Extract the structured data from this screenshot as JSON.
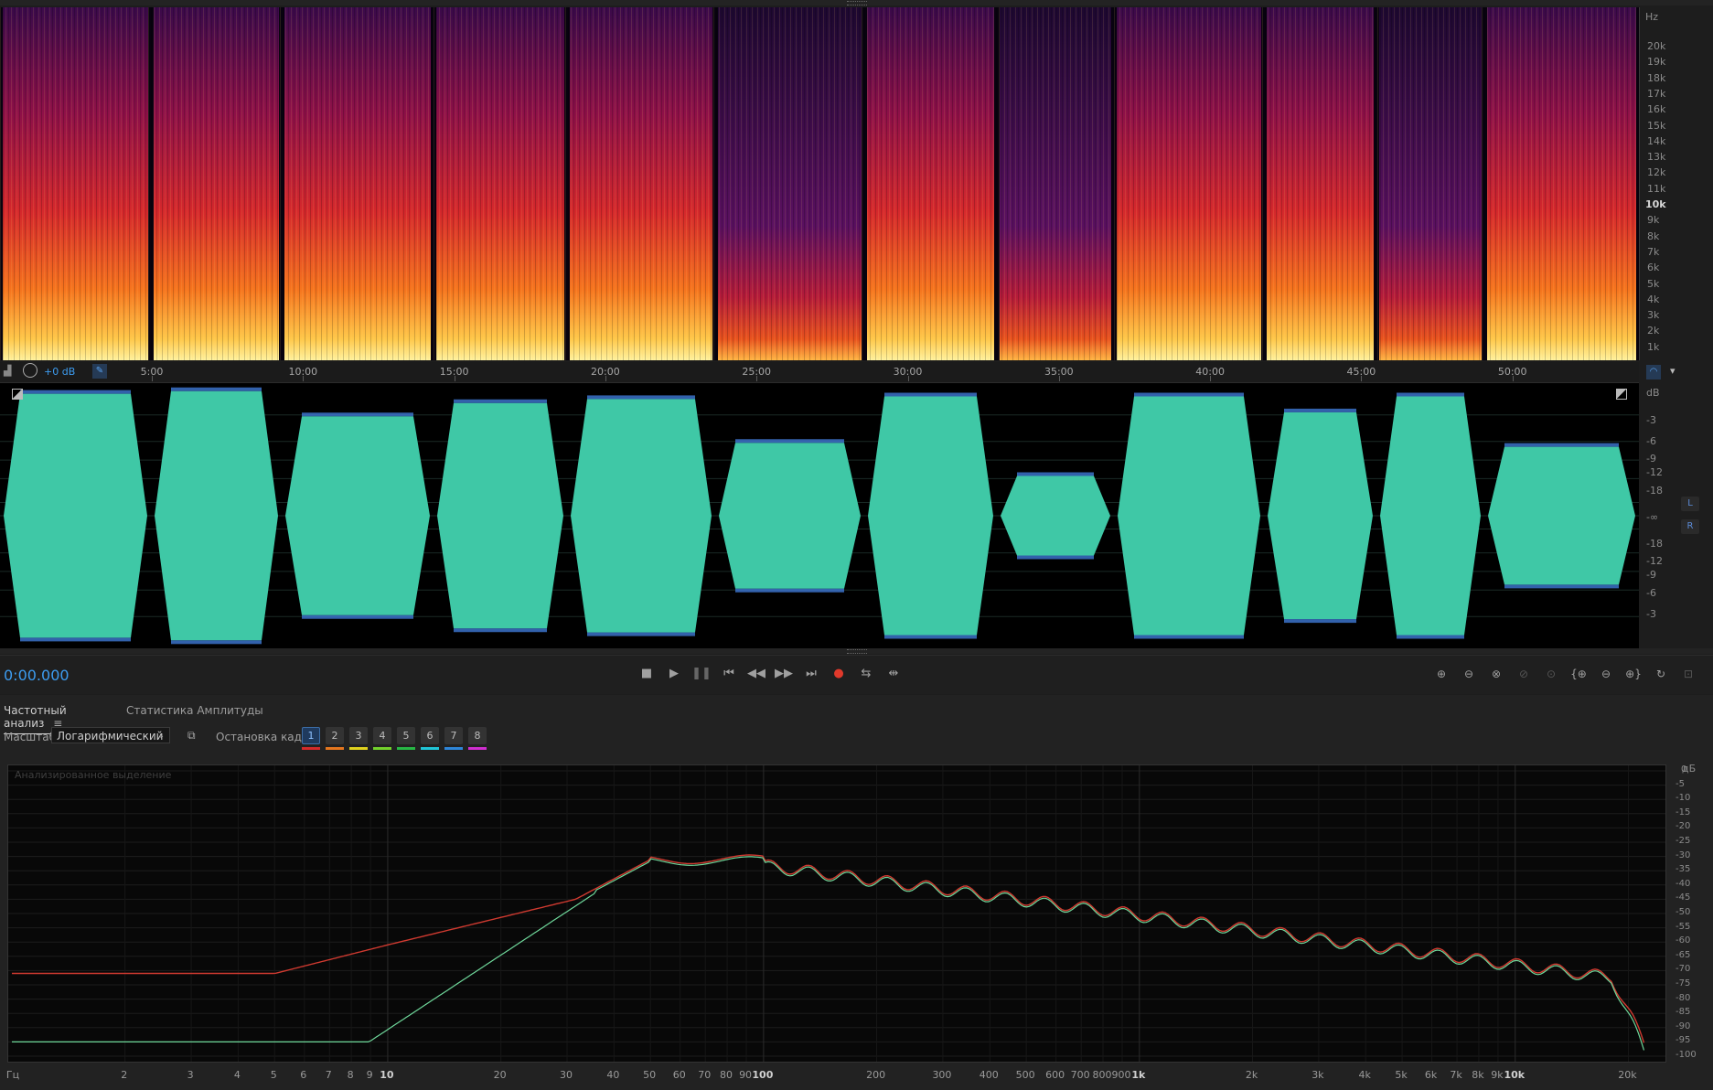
{
  "spectrogram": {
    "unit": "Hz",
    "freq_ticks": [
      {
        "label": "20k",
        "bold": false
      },
      {
        "label": "19k",
        "bold": false
      },
      {
        "label": "18k",
        "bold": false
      },
      {
        "label": "17k",
        "bold": false
      },
      {
        "label": "16k",
        "bold": false
      },
      {
        "label": "15k",
        "bold": false
      },
      {
        "label": "14k",
        "bold": false
      },
      {
        "label": "13k",
        "bold": false
      },
      {
        "label": "12k",
        "bold": false
      },
      {
        "label": "11k",
        "bold": false
      },
      {
        "label": "10k",
        "bold": true
      },
      {
        "label": "9k",
        "bold": false
      },
      {
        "label": "8k",
        "bold": false
      },
      {
        "label": "7k",
        "bold": false
      },
      {
        "label": "6k",
        "bold": false
      },
      {
        "label": "5k",
        "bold": false
      },
      {
        "label": "4k",
        "bold": false
      },
      {
        "label": "3k",
        "bold": false
      },
      {
        "label": "2k",
        "bold": false
      },
      {
        "label": "1k",
        "bold": false
      }
    ]
  },
  "timeline": {
    "gain": "+0 dB",
    "labels": [
      "5:00",
      "10:00",
      "15:00",
      "20:00",
      "25:00",
      "30:00",
      "35:00",
      "40:00",
      "45:00",
      "50:00"
    ]
  },
  "waveform": {
    "unit": "dB",
    "scale_top": [
      "-3",
      "-6",
      "-9",
      "-12",
      "-18"
    ],
    "center": "-∞",
    "scale_bottom": [
      "-18",
      "-12",
      "-9",
      "-6",
      "-3"
    ],
    "channels": [
      "L",
      "R"
    ],
    "color": "#3fc8a6",
    "peak_color": "#3f79d6"
  },
  "transport": {
    "timecode": "0:00.000"
  },
  "analysis": {
    "tabs": [
      "Частотный анализ",
      "Статистика Амплитуды"
    ],
    "scale_label": "Масштаб:",
    "scale_value": "Логарифмический",
    "hold_label": "Остановка кадра:",
    "frames": [
      "1",
      "2",
      "3",
      "4",
      "5",
      "6",
      "7",
      "8"
    ],
    "frame_colors": [
      "#d42a2a",
      "#e5761e",
      "#e0d21e",
      "#73d22c",
      "#27b845",
      "#20c6d8",
      "#2e86d9",
      "#d02ed0"
    ],
    "caption": "Анализированное выделение",
    "db_unit": "дБ",
    "db_ticks": [
      "0",
      "-5",
      "-10",
      "-15",
      "-20",
      "-25",
      "-30",
      "-35",
      "-40",
      "-45",
      "-50",
      "-55",
      "-60",
      "-65",
      "-70",
      "-75",
      "-80",
      "-85",
      "-90",
      "-95",
      "-100"
    ],
    "freq_unit": "Гц",
    "freq_ticks": [
      {
        "label": "2",
        "bold": false
      },
      {
        "label": "3",
        "bold": false
      },
      {
        "label": "4",
        "bold": false
      },
      {
        "label": "5",
        "bold": false
      },
      {
        "label": "6",
        "bold": false
      },
      {
        "label": "7",
        "bold": false
      },
      {
        "label": "8",
        "bold": false
      },
      {
        "label": "9",
        "bold": false
      },
      {
        "label": "10",
        "bold": true
      },
      {
        "label": "20",
        "bold": false
      },
      {
        "label": "30",
        "bold": false
      },
      {
        "label": "40",
        "bold": false
      },
      {
        "label": "50",
        "bold": false
      },
      {
        "label": "60",
        "bold": false
      },
      {
        "label": "70",
        "bold": false
      },
      {
        "label": "80",
        "bold": false
      },
      {
        "label": "90",
        "bold": false
      },
      {
        "label": "100",
        "bold": true
      },
      {
        "label": "200",
        "bold": false
      },
      {
        "label": "300",
        "bold": false
      },
      {
        "label": "400",
        "bold": false
      },
      {
        "label": "500",
        "bold": false
      },
      {
        "label": "600",
        "bold": false
      },
      {
        "label": "700",
        "bold": false
      },
      {
        "label": "800",
        "bold": false
      },
      {
        "label": "900",
        "bold": false
      },
      {
        "label": "1k",
        "bold": true
      },
      {
        "label": "2k",
        "bold": false
      },
      {
        "label": "3k",
        "bold": false
      },
      {
        "label": "4k",
        "bold": false
      },
      {
        "label": "5k",
        "bold": false
      },
      {
        "label": "6k",
        "bold": false
      },
      {
        "label": "7k",
        "bold": false
      },
      {
        "label": "8k",
        "bold": false
      },
      {
        "label": "9k",
        "bold": false
      },
      {
        "label": "10k",
        "bold": true
      },
      {
        "label": "20k",
        "bold": false
      }
    ],
    "curve_colors": {
      "hold": "#d03a30",
      "live": "#6fd89b"
    }
  }
}
